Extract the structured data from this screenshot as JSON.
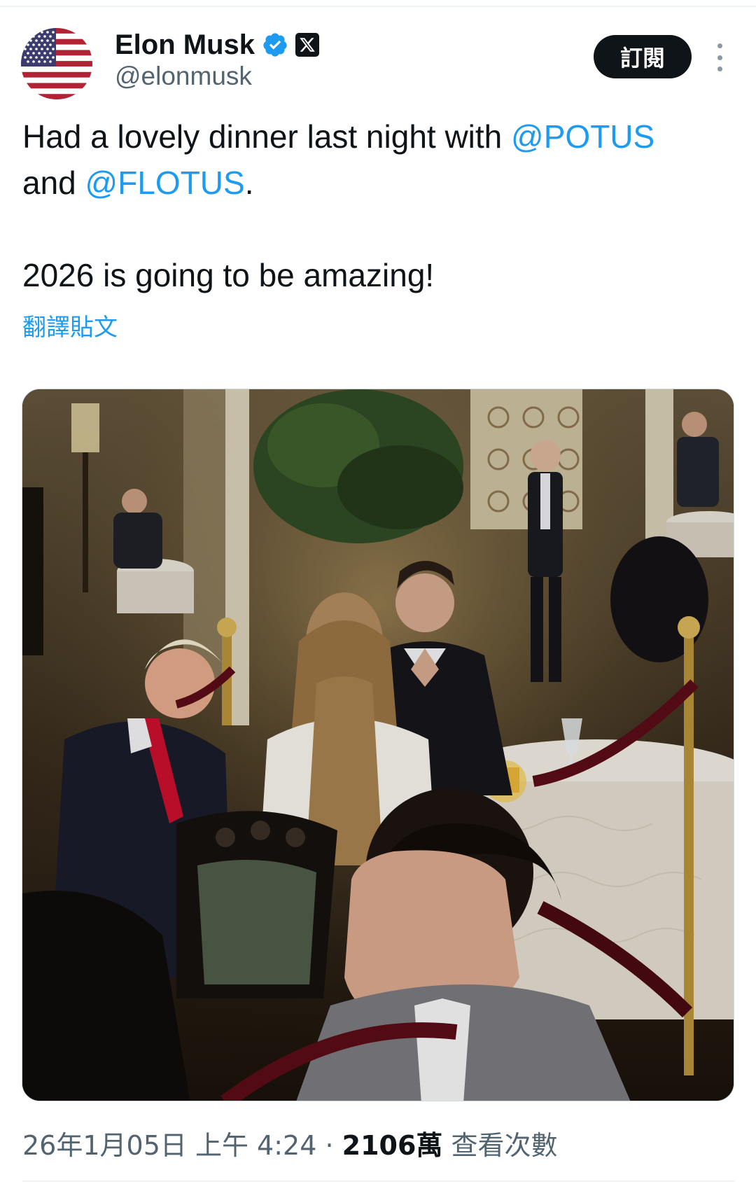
{
  "author": {
    "display_name": "Elon Musk",
    "handle": "@elonmusk",
    "avatar_icon": "us-flag-avatar",
    "verified_icon": "verified-badge-icon",
    "affiliate_icon": "x-logo-icon"
  },
  "actions": {
    "subscribe_label": "訂閱",
    "more_icon": "more-vertical-icon"
  },
  "tweet": {
    "line1_prefix": "Had a lovely dinner last night with ",
    "mention1": "@POTUS",
    "line2_prefix": "and ",
    "mention2": "@FLOTUS",
    "line2_suffix": ".",
    "line3": "2026 is going to be amazing!",
    "translate_label": "翻譯貼文"
  },
  "media": {
    "type": "photo"
  },
  "meta": {
    "timestamp": "26年1月05日 上午 4:24",
    "separator": " · ",
    "views_count": "2106萬",
    "views_label": " 查看次數"
  },
  "colors": {
    "link": "#1d9bf0",
    "text": "#0f1419",
    "secondary": "#536471",
    "verified": "#1d9bf0"
  }
}
